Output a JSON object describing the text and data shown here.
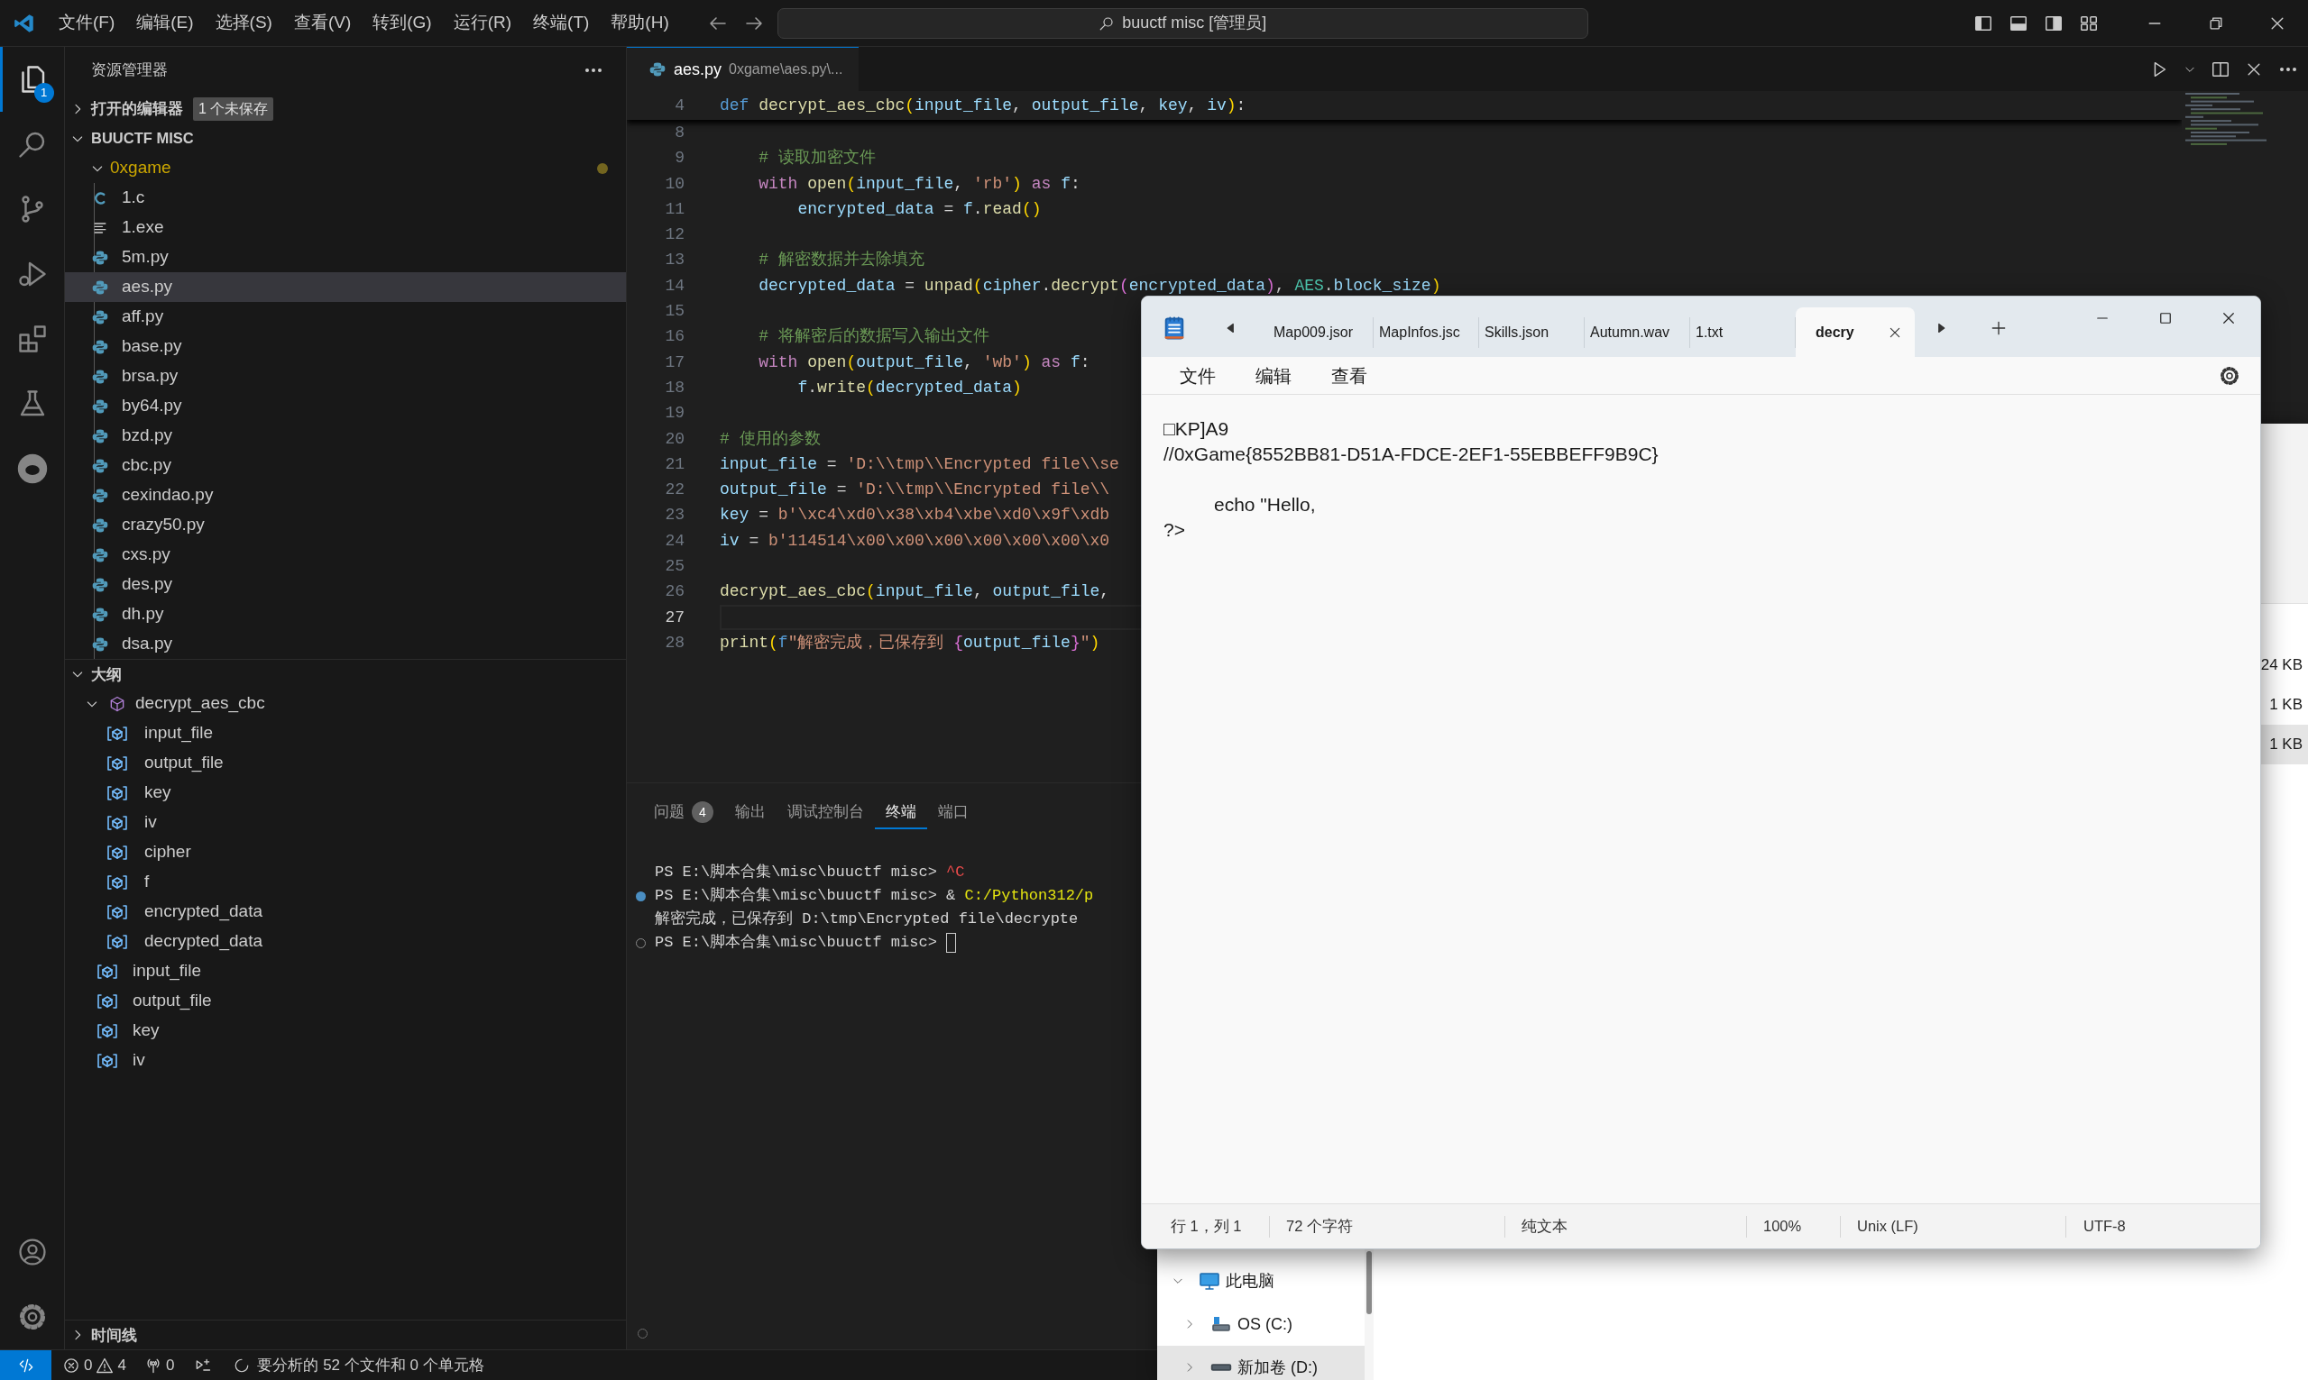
{
  "title_bar": {
    "menus": [
      "文件(F)",
      "编辑(E)",
      "选择(S)",
      "查看(V)",
      "转到(G)",
      "运行(R)",
      "终端(T)",
      "帮助(H)"
    ],
    "search": "buuctf misc [管理员]"
  },
  "activity_bar": {
    "items": [
      {
        "kind": "explorer",
        "selected": true,
        "badge": "1"
      },
      {
        "kind": "search",
        "selected": false
      },
      {
        "kind": "source_control",
        "selected": false
      },
      {
        "kind": "run",
        "selected": false
      },
      {
        "kind": "extensions",
        "selected": false
      },
      {
        "kind": "testing",
        "selected": false
      },
      {
        "kind": "extension_round",
        "selected": false
      }
    ],
    "bottom": [
      {
        "kind": "account"
      },
      {
        "kind": "manage"
      }
    ]
  },
  "sidebar": {
    "title": "资源管理器",
    "open_editors": {
      "label": "打开的编辑器",
      "badge": "1 个未保存",
      "expanded": false
    },
    "workspace": {
      "label": "BUUCTF MISC",
      "expanded": true,
      "folders": [
        {
          "name": "0xgame",
          "expanded": true,
          "modified": true,
          "children": [
            {
              "name": "1.c",
              "kind": "c",
              "selected": false
            },
            {
              "name": "1.exe",
              "kind": "text",
              "selected": false
            },
            {
              "name": "5m.py",
              "kind": "python",
              "selected": false
            },
            {
              "name": "aes.py",
              "kind": "python",
              "selected": true
            },
            {
              "name": "aff.py",
              "kind": "python",
              "selected": false
            },
            {
              "name": "base.py",
              "kind": "python",
              "selected": false
            },
            {
              "name": "brsa.py",
              "kind": "python",
              "selected": false
            },
            {
              "name": "by64.py",
              "kind": "python",
              "selected": false
            },
            {
              "name": "bzd.py",
              "kind": "python",
              "selected": false
            },
            {
              "name": "cbc.py",
              "kind": "python",
              "selected": false
            },
            {
              "name": "cexindao.py",
              "kind": "python",
              "selected": false
            },
            {
              "name": "crazy50.py",
              "kind": "python",
              "selected": false
            },
            {
              "name": "cxs.py",
              "kind": "python",
              "selected": false
            },
            {
              "name": "des.py",
              "kind": "python",
              "selected": false
            },
            {
              "name": "dh.py",
              "kind": "python",
              "selected": false
            },
            {
              "name": "dsa.py",
              "kind": "python",
              "selected": false
            }
          ]
        }
      ]
    },
    "outline": {
      "label": "大纲",
      "expanded": true,
      "items": [
        {
          "name": "decrypt_aes_cbc",
          "kind": "function",
          "expanded": true,
          "children": [
            {
              "name": "input_file",
              "kind": "variable"
            },
            {
              "name": "output_file",
              "kind": "variable"
            },
            {
              "name": "key",
              "kind": "variable"
            },
            {
              "name": "iv",
              "kind": "variable"
            },
            {
              "name": "cipher",
              "kind": "variable"
            },
            {
              "name": "f",
              "kind": "variable"
            },
            {
              "name": "encrypted_data",
              "kind": "variable"
            },
            {
              "name": "decrypted_data",
              "kind": "variable"
            }
          ]
        },
        {
          "name": "input_file",
          "kind": "variable"
        },
        {
          "name": "output_file",
          "kind": "variable"
        },
        {
          "name": "key",
          "kind": "variable"
        },
        {
          "name": "iv",
          "kind": "variable"
        }
      ]
    },
    "timeline": {
      "label": "时间线",
      "expanded": false
    }
  },
  "editor": {
    "tab": {
      "name": "aes.py",
      "description": "0xgame\\aes.py\\..."
    },
    "sticky": {
      "number": "4",
      "tokens": [
        {
          "text": "def ",
          "kind": "kw"
        },
        {
          "text": "decrypt_aes_cbc",
          "kind": "fn"
        },
        {
          "text": "(",
          "kind": "br1"
        },
        {
          "text": "input_file",
          "kind": "var"
        },
        {
          "text": ", ",
          "kind": "plain"
        },
        {
          "text": "output_file",
          "kind": "var"
        },
        {
          "text": ", ",
          "kind": "plain"
        },
        {
          "text": "key",
          "kind": "var"
        },
        {
          "text": ", ",
          "kind": "plain"
        },
        {
          "text": "iv",
          "kind": "var"
        },
        {
          "text": ")",
          "kind": "br1"
        },
        {
          "text": ":",
          "kind": "plain"
        }
      ]
    },
    "lines": [
      {
        "number": "8",
        "current": false
      },
      {
        "number": "9",
        "current": false,
        "tokens": [
          {
            "text": "    # 读取加密文件",
            "kind": "cm"
          }
        ]
      },
      {
        "number": "10",
        "current": false,
        "tokens": [
          {
            "text": "    with ",
            "kind": "ctrl"
          },
          {
            "text": "open",
            "kind": "fn"
          },
          {
            "text": "(",
            "kind": "br1"
          },
          {
            "text": "input_file",
            "kind": "var"
          },
          {
            "text": ", ",
            "kind": "plain"
          },
          {
            "text": "'rb'",
            "kind": "str"
          },
          {
            "text": ") ",
            "kind": "br1"
          },
          {
            "text": "as ",
            "kind": "ctrl"
          },
          {
            "text": "f",
            "kind": "var"
          },
          {
            "text": ":",
            "kind": "plain"
          }
        ]
      },
      {
        "number": "11",
        "current": false,
        "tokens": [
          {
            "text": "        encrypted_data",
            "kind": "var"
          },
          {
            "text": " = ",
            "kind": "plain"
          },
          {
            "text": "f",
            "kind": "var"
          },
          {
            "text": ".",
            "kind": "plain"
          },
          {
            "text": "read",
            "kind": "fn"
          },
          {
            "text": "()",
            "kind": "br1"
          }
        ]
      },
      {
        "number": "12",
        "current": false
      },
      {
        "number": "13",
        "current": false,
        "tokens": [
          {
            "text": "    # 解密数据并去除填充",
            "kind": "cm"
          }
        ]
      },
      {
        "number": "14",
        "current": false,
        "tokens": [
          {
            "text": "    decrypted_data",
            "kind": "var"
          },
          {
            "text": " = ",
            "kind": "plain"
          },
          {
            "text": "unpad",
            "kind": "fn"
          },
          {
            "text": "(",
            "kind": "br1"
          },
          {
            "text": "cipher",
            "kind": "var"
          },
          {
            "text": ".",
            "kind": "plain"
          },
          {
            "text": "decrypt",
            "kind": "fn"
          },
          {
            "text": "(",
            "kind": "br2"
          },
          {
            "text": "encrypted_data",
            "kind": "var"
          },
          {
            "text": ")",
            "kind": "br2"
          },
          {
            "text": ", ",
            "kind": "plain"
          },
          {
            "text": "AES",
            "kind": "cls"
          },
          {
            "text": ".",
            "kind": "plain"
          },
          {
            "text": "block_size",
            "kind": "var"
          },
          {
            "text": ")",
            "kind": "br1"
          }
        ]
      },
      {
        "number": "15",
        "current": false
      },
      {
        "number": "16",
        "current": false,
        "tokens": [
          {
            "text": "    # 将解密后的数据写入输出文件",
            "kind": "cm"
          }
        ]
      },
      {
        "number": "17",
        "current": false,
        "tokens": [
          {
            "text": "    with ",
            "kind": "ctrl"
          },
          {
            "text": "open",
            "kind": "fn"
          },
          {
            "text": "(",
            "kind": "br1"
          },
          {
            "text": "output_file",
            "kind": "var"
          },
          {
            "text": ", ",
            "kind": "plain"
          },
          {
            "text": "'wb'",
            "kind": "str"
          },
          {
            "text": ") ",
            "kind": "br1"
          },
          {
            "text": "as ",
            "kind": "ctrl"
          },
          {
            "text": "f",
            "kind": "var"
          },
          {
            "text": ":",
            "kind": "plain"
          }
        ]
      },
      {
        "number": "18",
        "current": false,
        "tokens": [
          {
            "text": "        f",
            "kind": "var"
          },
          {
            "text": ".",
            "kind": "plain"
          },
          {
            "text": "write",
            "kind": "fn"
          },
          {
            "text": "(",
            "kind": "br1"
          },
          {
            "text": "decrypted_data",
            "kind": "var"
          },
          {
            "text": ")",
            "kind": "br1"
          }
        ]
      },
      {
        "number": "19",
        "current": false
      },
      {
        "number": "20",
        "current": false,
        "tokens": [
          {
            "text": "# 使用的参数",
            "kind": "cm"
          }
        ]
      },
      {
        "number": "21",
        "current": false,
        "tokens": [
          {
            "text": "input_file",
            "kind": "var"
          },
          {
            "text": " = ",
            "kind": "plain"
          },
          {
            "text": "'D:\\\\tmp\\\\Encrypted file\\\\se",
            "kind": "str"
          }
        ]
      },
      {
        "number": "22",
        "current": false,
        "tokens": [
          {
            "text": "output_file",
            "kind": "var"
          },
          {
            "text": " = ",
            "kind": "plain"
          },
          {
            "text": "'D:\\\\tmp\\\\Encrypted file\\\\",
            "kind": "str"
          }
        ]
      },
      {
        "number": "23",
        "current": false,
        "tokens": [
          {
            "text": "key",
            "kind": "var"
          },
          {
            "text": " = ",
            "kind": "plain"
          },
          {
            "text": "b'\\xc4\\xd0\\x38\\xb4\\xbe\\xd0\\x9f\\xdb",
            "kind": "str"
          }
        ]
      },
      {
        "number": "24",
        "current": false,
        "tokens": [
          {
            "text": "iv",
            "kind": "var"
          },
          {
            "text": " = ",
            "kind": "plain"
          },
          {
            "text": "b'114514\\x00\\x00\\x00\\x00\\x00\\x00\\x0",
            "kind": "str"
          }
        ]
      },
      {
        "number": "25",
        "current": false
      },
      {
        "number": "26",
        "current": false,
        "tokens": [
          {
            "text": "decrypt_aes_cbc",
            "kind": "fn"
          },
          {
            "text": "(",
            "kind": "br1"
          },
          {
            "text": "input_file",
            "kind": "var"
          },
          {
            "text": ", ",
            "kind": "plain"
          },
          {
            "text": "output_file",
            "kind": "var"
          },
          {
            "text": ",",
            "kind": "plain"
          }
        ]
      },
      {
        "number": "27",
        "current": true
      },
      {
        "number": "28",
        "current": false,
        "tokens": [
          {
            "text": "print",
            "kind": "fn"
          },
          {
            "text": "(",
            "kind": "br1"
          },
          {
            "text": "f",
            "kind": "kw"
          },
          {
            "text": "\"解密完成，已保存到 ",
            "kind": "str"
          },
          {
            "text": "{",
            "kind": "br2"
          },
          {
            "text": "output_file",
            "kind": "var"
          },
          {
            "text": "}",
            "kind": "br2"
          },
          {
            "text": "\"",
            "kind": "str"
          },
          {
            "text": ")",
            "kind": "br1"
          }
        ]
      }
    ]
  },
  "panel": {
    "tabs": [
      {
        "label": "问题",
        "badge": "4",
        "selected": false
      },
      {
        "label": "输出",
        "selected": false
      },
      {
        "label": "调试控制台",
        "selected": false
      },
      {
        "label": "终端",
        "selected": true
      },
      {
        "label": "端口",
        "selected": false
      }
    ],
    "terminal": [
      {
        "kind": "plain",
        "cursor": false,
        "tokens": [
          {
            "text": "PS E:\\脚本合集\\misc\\buuctf misc> ",
            "kind": "plain"
          },
          {
            "text": "^C",
            "kind": "red"
          }
        ]
      },
      {
        "kind": "success",
        "cursor": false,
        "tokens": [
          {
            "text": "PS E:\\脚本合集\\misc\\buuctf misc> & ",
            "kind": "plain"
          },
          {
            "text": "C:/Python312/p",
            "kind": "yellow"
          }
        ]
      },
      {
        "kind": "plain",
        "cursor": false,
        "tokens": [
          {
            "text": "解密完成，已保存到 D:\\tmp\\Encrypted file\\decrypte",
            "kind": "plain"
          }
        ]
      },
      {
        "kind": "pending",
        "cursor": true,
        "tokens": [
          {
            "text": "PS E:\\脚本合集\\misc\\buuctf misc> ",
            "kind": "plain"
          }
        ]
      }
    ]
  },
  "status_bar": {
    "errors": "0",
    "warnings": "4",
    "ports": "0",
    "analysis": "要分析的 52 个文件和 0 个单元格"
  },
  "file_explorer": {
    "sizes": [
      {
        "text": "24 KB",
        "selected": false
      },
      {
        "text": "1 KB",
        "selected": false
      },
      {
        "text": "1 KB",
        "selected": true
      }
    ],
    "nav": [
      {
        "label": "此电脑",
        "kind": "pc",
        "expanded": true,
        "selected": false,
        "children": [
          {
            "label": "OS (C:)",
            "kind": "system_drive",
            "expanded": false,
            "selected": false
          },
          {
            "label": "新加卷 (D:)",
            "kind": "drive",
            "expanded": false,
            "selected": true
          }
        ]
      }
    ]
  },
  "notepad": {
    "tabs": [
      {
        "label": "Map009.jsor",
        "selected": false
      },
      {
        "label": "MapInfos.jsc",
        "selected": false
      },
      {
        "label": "Skills.json",
        "selected": false
      },
      {
        "label": "Autumn.wav",
        "selected": false
      },
      {
        "label": "1.txt",
        "selected": false
      },
      {
        "label": "decry",
        "selected": true
      }
    ],
    "menus": [
      "文件",
      "编辑",
      "查看"
    ],
    "content": "□KP]A9\n//0xGame{8552BB81-D51A-FDCE-2EF1-55EBBEFF9B9C}\n\n\techo \"Hello,\n?>",
    "status": [
      "行 1，列 1",
      "72 个字符",
      "纯文本",
      "100%",
      "Unix (LF)",
      "UTF-8"
    ]
  }
}
